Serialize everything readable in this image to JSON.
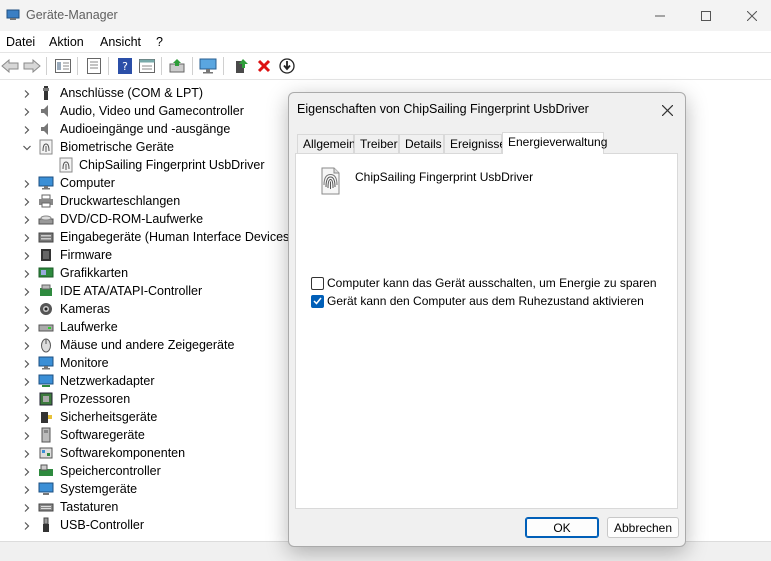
{
  "window": {
    "title": "Geräte-Manager"
  },
  "menu": [
    "Datei",
    "Aktion",
    "Ansicht",
    "?"
  ],
  "toolbar_icons": [
    "back-arrow-icon",
    "forward-arrow-icon",
    "properties-view-icon",
    "list-view-icon",
    "help-icon",
    "details-view-icon",
    "update-driver-icon",
    "scan-hardware-icon",
    "enable-device-icon",
    "uninstall-icon",
    "download-icon"
  ],
  "tree": [
    {
      "label": "Anschlüsse (COM & LPT)",
      "icon": "port-icon",
      "expanded": false
    },
    {
      "label": "Audio, Video und Gamecontroller",
      "icon": "speaker-icon",
      "expanded": false
    },
    {
      "label": "Audioeingänge und -ausgänge",
      "icon": "speaker-icon",
      "expanded": false
    },
    {
      "label": "Biometrische Geräte",
      "icon": "fingerprint-icon",
      "expanded": true
    },
    {
      "label": "ChipSailing Fingerprint UsbDriver",
      "icon": "fingerprint-icon",
      "child": true
    },
    {
      "label": "Computer",
      "icon": "monitor-icon",
      "expanded": false
    },
    {
      "label": "Druckwarteschlangen",
      "icon": "printer-icon",
      "expanded": false
    },
    {
      "label": "DVD/CD-ROM-Laufwerke",
      "icon": "disc-drive-icon",
      "expanded": false
    },
    {
      "label": "Eingabegeräte (Human Interface Devices)",
      "icon": "hid-icon",
      "expanded": false
    },
    {
      "label": "Firmware",
      "icon": "chip-icon",
      "expanded": false
    },
    {
      "label": "Grafikkarten",
      "icon": "display-adapter-icon",
      "expanded": false
    },
    {
      "label": "IDE ATA/ATAPI-Controller",
      "icon": "ide-controller-icon",
      "expanded": false
    },
    {
      "label": "Kameras",
      "icon": "camera-icon",
      "expanded": false
    },
    {
      "label": "Laufwerke",
      "icon": "disk-drive-icon",
      "expanded": false
    },
    {
      "label": "Mäuse und andere Zeigegeräte",
      "icon": "mouse-icon",
      "expanded": false
    },
    {
      "label": "Monitore",
      "icon": "monitor-icon",
      "expanded": false
    },
    {
      "label": "Netzwerkadapter",
      "icon": "network-icon",
      "expanded": false
    },
    {
      "label": "Prozessoren",
      "icon": "processor-icon",
      "expanded": false
    },
    {
      "label": "Sicherheitsgeräte",
      "icon": "security-icon",
      "expanded": false
    },
    {
      "label": "Softwaregeräte",
      "icon": "software-device-icon",
      "expanded": false
    },
    {
      "label": "Softwarekomponenten",
      "icon": "software-component-icon",
      "expanded": false
    },
    {
      "label": "Speichercontroller",
      "icon": "storage-controller-icon",
      "expanded": false
    },
    {
      "label": "Systemgeräte",
      "icon": "system-device-icon",
      "expanded": false
    },
    {
      "label": "Tastaturen",
      "icon": "keyboard-icon",
      "expanded": false
    },
    {
      "label": "USB-Controller",
      "icon": "usb-icon",
      "expanded": false
    }
  ],
  "dialog": {
    "title": "Eigenschaften von ChipSailing Fingerprint UsbDriver",
    "tabs": [
      "Allgemein",
      "Treiber",
      "Details",
      "Ereignisse",
      "Energieverwaltung"
    ],
    "active_tab": "Energieverwaltung",
    "device_name": "ChipSailing Fingerprint UsbDriver",
    "options": [
      {
        "label": "Computer kann das Gerät ausschalten, um Energie zu sparen",
        "checked": false
      },
      {
        "label": "Gerät kann den Computer aus dem Ruhezustand aktivieren",
        "checked": true
      }
    ],
    "ok_label": "OK",
    "cancel_label": "Abbrechen"
  },
  "colors": {
    "accent": "#005fb8",
    "titlebar": "#f3f3f3",
    "dialog_bg": "#f0f0f0"
  }
}
